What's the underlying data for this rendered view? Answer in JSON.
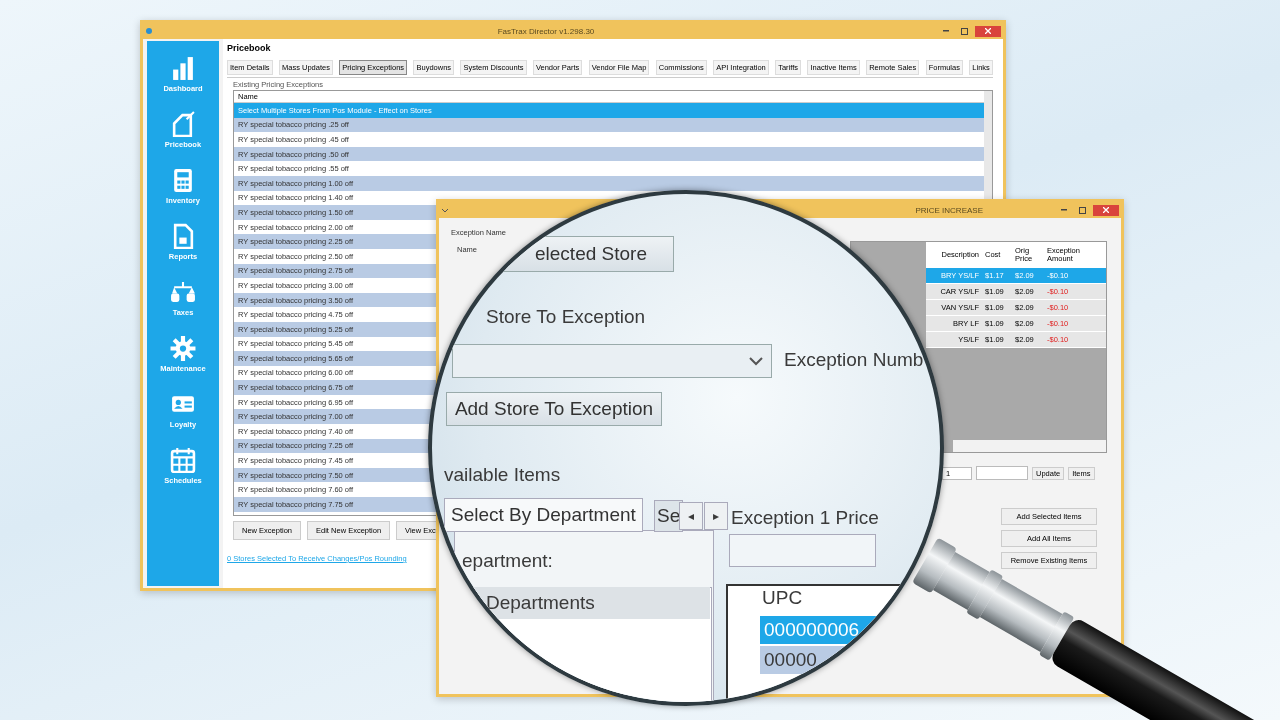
{
  "main_window": {
    "title": "FasTrax Director v1.298.30",
    "sidebar": [
      {
        "label": "Dashboard"
      },
      {
        "label": "Pricebook"
      },
      {
        "label": "Inventory"
      },
      {
        "label": "Reports"
      },
      {
        "label": "Taxes"
      },
      {
        "label": "Maintenance"
      },
      {
        "label": "Loyalty"
      },
      {
        "label": "Schedules"
      }
    ],
    "section_title": "Pricebook",
    "tabs": [
      {
        "label": "Item Details",
        "selected": false
      },
      {
        "label": "Mass Updates",
        "selected": false
      },
      {
        "label": "Pricing Exceptions",
        "selected": true
      },
      {
        "label": "Buydowns",
        "selected": false
      },
      {
        "label": "System Discounts",
        "selected": false
      },
      {
        "label": "Vendor Parts",
        "selected": false
      },
      {
        "label": "Vendor File Map",
        "selected": false
      },
      {
        "label": "Commissions",
        "selected": false
      },
      {
        "label": "API Integration",
        "selected": false
      },
      {
        "label": "Tariffs",
        "selected": false
      },
      {
        "label": "Inactive Items",
        "selected": false
      },
      {
        "label": "Remote Sales",
        "selected": false
      },
      {
        "label": "Formulas",
        "selected": false
      },
      {
        "label": "Links",
        "selected": false
      }
    ],
    "list_group": "Existing Pricing Exceptions",
    "list_header": "Name",
    "rows": [
      {
        "name": "Select Multiple Stores From Pos Module - Effect on Stores",
        "selected": true
      },
      {
        "name": "RY special tobacco pricing .25 off",
        "selected": false
      },
      {
        "name": "RY special tobacco pricing .45 off",
        "selected": false
      },
      {
        "name": "RY special tobacco pricing .50 off",
        "selected": false
      },
      {
        "name": "RY special tobacco pricing .55 off",
        "selected": false
      },
      {
        "name": "RY special tobacco pricing 1.00 off",
        "selected": false
      },
      {
        "name": "RY special tobacco pricing 1.40 off",
        "selected": false
      },
      {
        "name": "RY special tobacco pricing 1.50 off",
        "selected": false
      },
      {
        "name": "RY special tobacco pricing 2.00 off",
        "selected": false
      },
      {
        "name": "RY special tobacco pricing 2.25 off",
        "selected": false
      },
      {
        "name": "RY special tobacco pricing 2.50 off",
        "selected": false
      },
      {
        "name": "RY special tobacco pricing 2.75 off",
        "selected": false
      },
      {
        "name": "RY special tobacco pricing 3.00 off",
        "selected": false
      },
      {
        "name": "RY special tobacco pricing 3.50 off",
        "selected": false
      },
      {
        "name": "RY special tobacco pricing 4.75 off",
        "selected": false
      },
      {
        "name": "RY special tobacco pricing 5.25 off",
        "selected": false
      },
      {
        "name": "RY special tobacco pricing 5.45 off",
        "selected": false
      },
      {
        "name": "RY special tobacco pricing 5.65 off",
        "selected": false
      },
      {
        "name": "RY special tobacco pricing 6.00 off",
        "selected": false
      },
      {
        "name": "RY special tobacco pricing 6.75 off",
        "selected": false
      },
      {
        "name": "RY special tobacco pricing 6.95 off",
        "selected": false
      },
      {
        "name": "RY special tobacco pricing 7.00 off",
        "selected": false
      },
      {
        "name": "RY special tobacco pricing 7.40 off",
        "selected": false
      },
      {
        "name": "RY special tobacco pricing 7.25 off",
        "selected": false
      },
      {
        "name": "RY special tobacco pricing 7.45 off",
        "selected": false
      },
      {
        "name": "RY special tobacco pricing 7.50 off",
        "selected": false
      },
      {
        "name": "RY special tobacco pricing 7.60 off",
        "selected": false
      },
      {
        "name": "RY special tobacco pricing 7.75 off",
        "selected": false
      }
    ],
    "buttons": [
      "New Exception",
      "Edit New Exception",
      "View Exc"
    ],
    "link": "0 Stores Selected To Receive Changes/Pos Rounding"
  },
  "exception_window": {
    "title": "PRICE INCREASE",
    "labels": [
      "Exception Name",
      "Name"
    ],
    "columns": [
      "Description",
      "Cost",
      "Orig Price",
      "Exception Amount"
    ],
    "rows": [
      {
        "description": "BRY YS/LF",
        "cost": "$1.17",
        "price": "$2.09",
        "amount": "-$0.10",
        "selected": true
      },
      {
        "description": "CAR YS/LF",
        "cost": "$1.09",
        "price": "$2.09",
        "amount": "-$0.10",
        "selected": false
      },
      {
        "description": "VAN YS/LF",
        "cost": "$1.09",
        "price": "$2.09",
        "amount": "-$0.10",
        "selected": false
      },
      {
        "description": "BRY LF",
        "cost": "$1.09",
        "price": "$2.09",
        "amount": "-$0.10",
        "selected": false
      },
      {
        "description": "YS/LF",
        "cost": "$1.09",
        "price": "$2.09",
        "amount": "-$0.10",
        "selected": false
      }
    ],
    "qty": "1",
    "update_button": "Update",
    "items_button": "Items",
    "buttons": [
      "Add Selected Items",
      "Add All Items",
      "Remove Existing Items"
    ]
  },
  "magnifier": {
    "selected_store_button": "elected Store",
    "store_label": "Store To Exception",
    "exception_number_label": "Exception Numb",
    "add_store_button": "Add Store To Exception",
    "available_items_label": "vailable Items",
    "tabs": [
      {
        "label": "Select By Department",
        "selected": true
      },
      {
        "label": "Se",
        "selected": false
      }
    ],
    "scroll_left": "◂",
    "scroll_right": "▸",
    "exception_price_label": "Exception 1 Price",
    "department_label": "epartment:",
    "departments_header": "Departments",
    "upc_header": "UPC",
    "upc_rows": [
      {
        "value": "000000006",
        "selected": true
      },
      {
        "value": "00000",
        "selected": false
      }
    ]
  }
}
